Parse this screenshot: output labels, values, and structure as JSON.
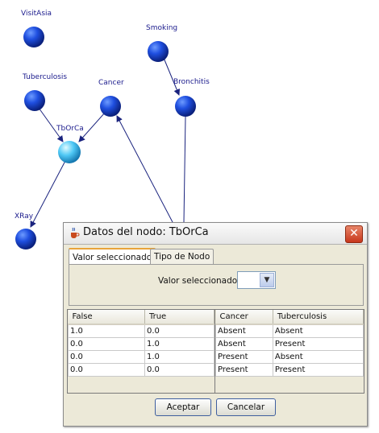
{
  "graph": {
    "nodes": [
      {
        "id": "visitasia",
        "label": "VisitAsia"
      },
      {
        "id": "smoking",
        "label": "Smoking"
      },
      {
        "id": "tuberculosis",
        "label": "Tuberculosis"
      },
      {
        "id": "cancer",
        "label": "Cancer"
      },
      {
        "id": "bronchitis",
        "label": "Bronchitis"
      },
      {
        "id": "tborca",
        "label": "TbOrCa"
      },
      {
        "id": "xray",
        "label": "XRay"
      }
    ]
  },
  "dialog": {
    "title": "Datos del nodo: TbOrCa",
    "close_label": "✕",
    "tabs": [
      {
        "label": "Valor seleccionado",
        "active": true
      },
      {
        "label": "Tipo de Nodo",
        "active": false
      }
    ],
    "selected_value_label": "Valor seleccionado",
    "selected_value": "",
    "left_table": {
      "columns": [
        "False",
        "True"
      ],
      "rows": [
        [
          "1.0",
          "0.0"
        ],
        [
          "0.0",
          "1.0"
        ],
        [
          "0.0",
          "1.0"
        ],
        [
          "0.0",
          "0.0"
        ]
      ]
    },
    "right_table": {
      "columns": [
        "Cancer",
        "Tuberculosis"
      ],
      "rows": [
        [
          "Absent",
          "Absent"
        ],
        [
          "Absent",
          "Present"
        ],
        [
          "Present",
          "Absent"
        ],
        [
          "Present",
          "Present"
        ]
      ]
    },
    "ok_label": "Aceptar",
    "cancel_label": "Cancelar"
  },
  "colors": {
    "node": "#1a4fd6",
    "selected_node": "#4fc3f7",
    "edge": "#1a237e",
    "close_bg": "#c7361b"
  }
}
